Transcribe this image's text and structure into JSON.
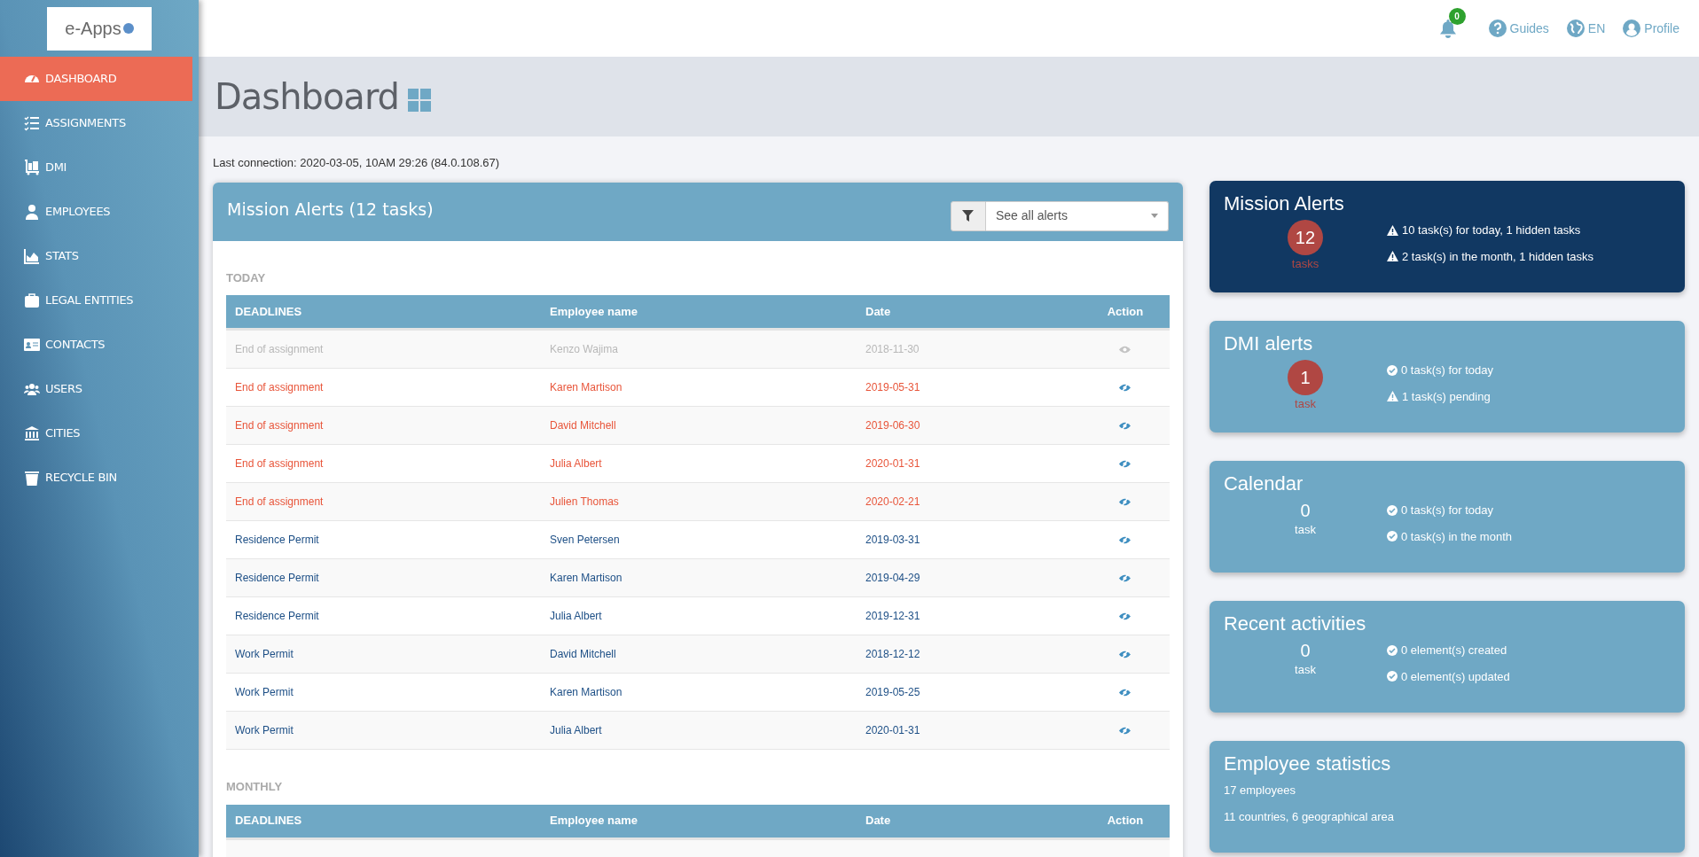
{
  "sidebar": {
    "logo": "e-Apps",
    "items": [
      {
        "label": "DASHBOARD",
        "selected": true
      },
      {
        "label": "ASSIGNMENTS",
        "selected": false
      },
      {
        "label": "DMI",
        "selected": false
      },
      {
        "label": "EMPLOYEES",
        "selected": false
      },
      {
        "label": "STATS",
        "selected": false
      },
      {
        "label": "LEGAL ENTITIES",
        "selected": false
      },
      {
        "label": "CONTACTS",
        "selected": false
      },
      {
        "label": "USERS",
        "selected": false
      },
      {
        "label": "CITIES",
        "selected": false
      },
      {
        "label": "RECYCLE BIN",
        "selected": false
      }
    ]
  },
  "topbar": {
    "notifications": "0",
    "links": [
      "Guides",
      "EN",
      "Profile"
    ]
  },
  "page_title": "Dashboard",
  "last_connection": "Last connection: 2020-03-05, 10AM 29:26 (84.0.108.67)",
  "alerts_panel": {
    "title": "Mission Alerts (12 tasks)",
    "filter": {
      "value": "See all alerts"
    },
    "sections": [
      {
        "heading": "TODAY",
        "columns": [
          "DEADLINES",
          "Employee name",
          "Date",
          "Action"
        ],
        "rows": [
          {
            "kind": "faded",
            "deadline": "End of assignment",
            "employee": "Kenzo Wajima",
            "date": "2018-11-30"
          },
          {
            "kind": "overdue",
            "deadline": "End of assignment",
            "employee": "Karen Martison",
            "date": "2019-05-31"
          },
          {
            "kind": "overdue",
            "deadline": "End of assignment",
            "employee": "David Mitchell",
            "date": "2019-06-30"
          },
          {
            "kind": "overdue",
            "deadline": "End of assignment",
            "employee": "Julia Albert",
            "date": "2020-01-31"
          },
          {
            "kind": "overdue",
            "deadline": "End of assignment",
            "employee": "Julien Thomas",
            "date": "2020-02-21"
          },
          {
            "kind": "normal",
            "deadline": "Residence Permit",
            "employee": "Sven Petersen",
            "date": "2019-03-31"
          },
          {
            "kind": "normal",
            "deadline": "Residence Permit",
            "employee": "Karen Martison",
            "date": "2019-04-29"
          },
          {
            "kind": "normal",
            "deadline": "Residence Permit",
            "employee": "Julia Albert",
            "date": "2019-12-31"
          },
          {
            "kind": "normal",
            "deadline": "Work Permit",
            "employee": "David Mitchell",
            "date": "2018-12-12"
          },
          {
            "kind": "normal",
            "deadline": "Work Permit",
            "employee": "Karen Martison",
            "date": "2019-05-25"
          },
          {
            "kind": "normal",
            "deadline": "Work Permit",
            "employee": "Julia Albert",
            "date": "2020-01-31"
          }
        ]
      },
      {
        "heading": "MONTHLY",
        "columns": [
          "DEADLINES",
          "Employee name",
          "Date",
          "Action"
        ]
      }
    ]
  },
  "cards": [
    {
      "kind": "dark",
      "title": "Mission Alerts",
      "count": "12",
      "count_unit": "tasks",
      "count_badge": true,
      "lines": [
        {
          "kind": "warning",
          "text": "10 task(s) for today, 1 hidden tasks"
        },
        {
          "kind": "warning",
          "text": "2 task(s) in the month, 1 hidden tasks"
        }
      ]
    },
    {
      "kind": "light",
      "title": "DMI alerts",
      "count": "1",
      "count_unit": "task",
      "count_badge": true,
      "lines": [
        {
          "kind": "check",
          "text": "0 task(s) for today"
        },
        {
          "kind": "warning",
          "text": "1 task(s) pending"
        }
      ]
    },
    {
      "kind": "light",
      "title": "Calendar",
      "count": "0",
      "count_unit": "task",
      "count_badge": false,
      "lines": [
        {
          "kind": "check",
          "text": "0 task(s) for today"
        },
        {
          "kind": "check",
          "text": "0 task(s) in the month"
        }
      ]
    },
    {
      "kind": "light",
      "title": "Recent activities",
      "count": "0",
      "count_unit": "task",
      "count_badge": false,
      "lines": [
        {
          "kind": "check",
          "text": "0 element(s) created"
        },
        {
          "kind": "check",
          "text": "0 element(s) updated"
        }
      ]
    },
    {
      "kind": "light",
      "title": "Employee statistics",
      "lines": [
        {
          "kind": "plain",
          "text": "17 employees"
        },
        {
          "kind": "plain",
          "text": "11 countries, 6 geographical area"
        }
      ]
    }
  ]
}
